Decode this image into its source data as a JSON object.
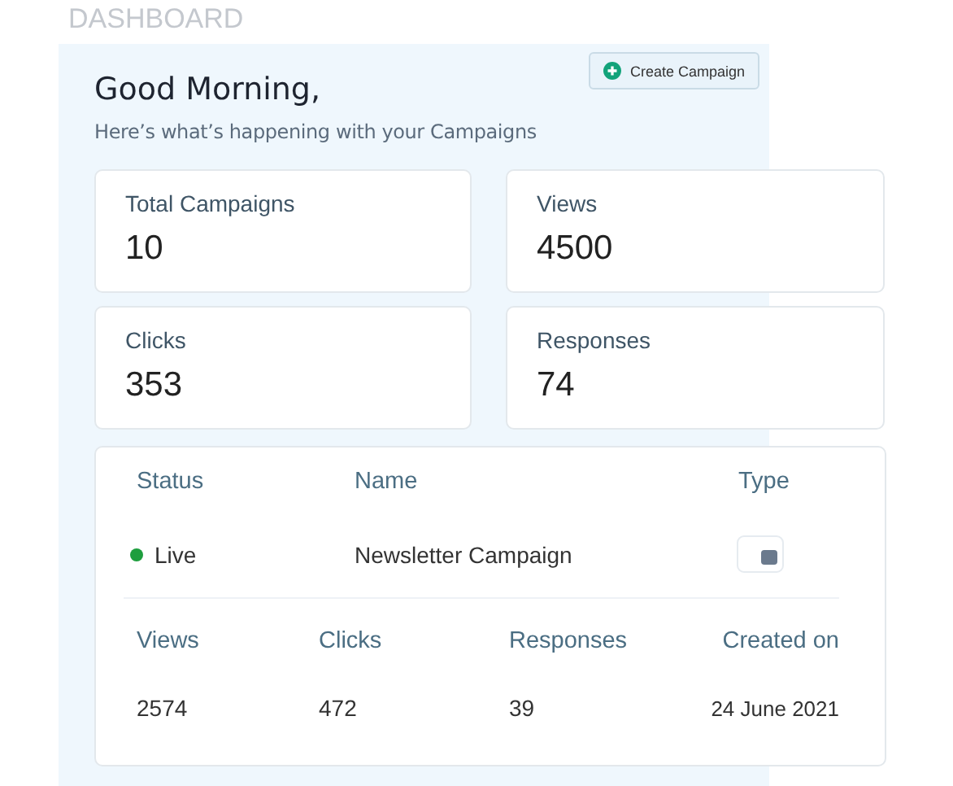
{
  "page_title": "DASHBOARD",
  "greeting": "Good Morning,",
  "subtitle": "Here’s what’s happening with your Campaigns",
  "create_button": {
    "label": "Create Campaign"
  },
  "stats": [
    {
      "label": "Total Campaigns",
      "value": "10"
    },
    {
      "label": "Views",
      "value": "4500"
    },
    {
      "label": "Clicks",
      "value": "353"
    },
    {
      "label": "Responses",
      "value": "74"
    }
  ],
  "campaign_table": {
    "columns": [
      "Status",
      "Name",
      "Type"
    ],
    "rows": [
      {
        "status": "Live",
        "color": "#1e9e3e",
        "name": "Newsletter Campaign"
      }
    ],
    "metric_columns": [
      "Views",
      "Clicks",
      "Responses",
      "Created on"
    ],
    "metric_rows": [
      [
        "2574",
        "472",
        "39",
        "24 June 2021"
      ]
    ]
  }
}
